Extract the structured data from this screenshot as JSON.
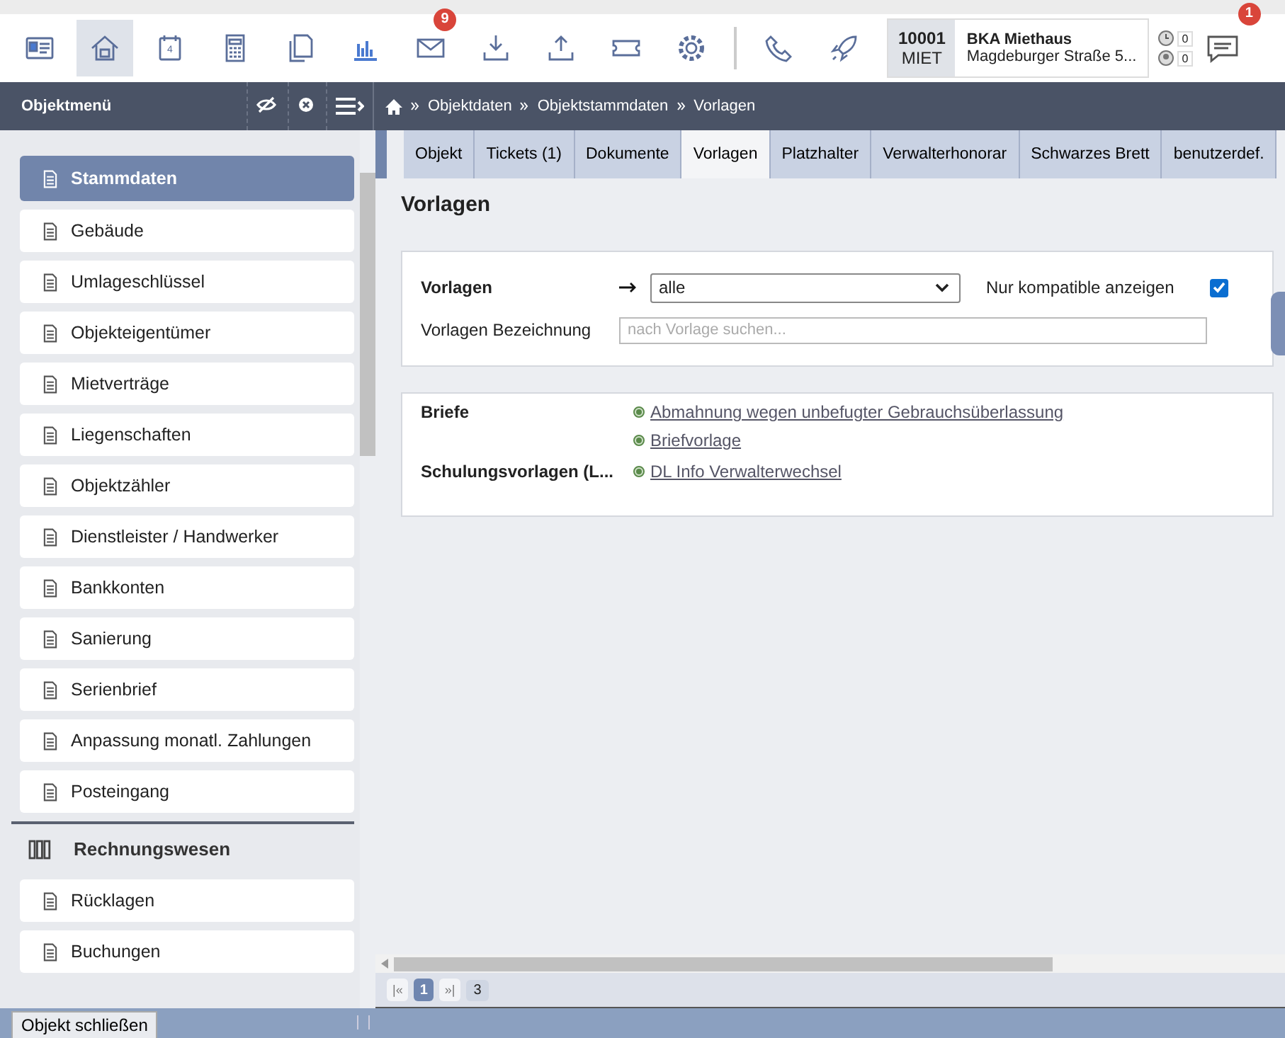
{
  "toolbar": {
    "icons": [
      {
        "kind": "card",
        "selected": false
      },
      {
        "kind": "home",
        "selected": true
      },
      {
        "kind": "calendar",
        "selected": false,
        "label": "4"
      },
      {
        "kind": "calculator",
        "selected": false
      },
      {
        "kind": "copy",
        "selected": false
      },
      {
        "kind": "chart",
        "selected": false
      },
      {
        "kind": "mail",
        "selected": false,
        "badge": "9"
      },
      {
        "kind": "download",
        "selected": false
      },
      {
        "kind": "upload",
        "selected": false
      },
      {
        "kind": "ticket",
        "selected": false
      },
      {
        "kind": "gear",
        "selected": false
      },
      {
        "kind": "divider"
      },
      {
        "kind": "phone",
        "selected": false
      },
      {
        "kind": "rocket",
        "selected": false
      }
    ],
    "object": {
      "number": "10001",
      "type": "MIET",
      "name": "BKA Miethaus",
      "address": "Magdeburger Straße 5..."
    },
    "counters": [
      "0",
      "0"
    ],
    "messages_badge": "1"
  },
  "menu_bar": {
    "title": "Objektmenü",
    "breadcrumb": [
      "Objektdaten",
      "Objektstammdaten",
      "Vorlagen"
    ]
  },
  "sidebar": {
    "items": [
      {
        "label": "Stammdaten",
        "selected": true
      },
      {
        "label": "Gebäude",
        "selected": false
      },
      {
        "label": "Umlageschlüssel",
        "selected": false
      },
      {
        "label": "Objekteigentümer",
        "selected": false
      },
      {
        "label": "Mietverträge",
        "selected": false
      },
      {
        "label": "Liegenschaften",
        "selected": false
      },
      {
        "label": "Objektzähler",
        "selected": false
      },
      {
        "label": "Dienstleister / Handwerker",
        "selected": false
      },
      {
        "label": "Bankkonten",
        "selected": false
      },
      {
        "label": "Sanierung",
        "selected": false
      },
      {
        "label": "Serienbrief",
        "selected": false
      },
      {
        "label": "Anpassung monatl. Zahlungen",
        "selected": false
      },
      {
        "label": "Posteingang",
        "selected": false
      }
    ],
    "group": {
      "title": "Rechnungswesen",
      "items": [
        {
          "label": "Rücklagen",
          "selected": false
        },
        {
          "label": "Buchungen",
          "selected": false
        }
      ]
    }
  },
  "tabs": [
    {
      "label": "Objekt",
      "selected": false
    },
    {
      "label": "Tickets (1)",
      "selected": false
    },
    {
      "label": "Dokumente",
      "selected": false
    },
    {
      "label": "Vorlagen",
      "selected": true
    },
    {
      "label": "Platzhalter",
      "selected": false
    },
    {
      "label": "Verwalterhonorar",
      "selected": false
    },
    {
      "label": "Schwarzes Brett",
      "selected": false
    },
    {
      "label": "benutzerdef.",
      "selected": false
    }
  ],
  "page_title": "Vorlagen",
  "filter": {
    "select_label": "Vorlagen",
    "select_value": "alle",
    "checkbox_label": "Nur kompatible anzeigen",
    "checked": true,
    "search_label": "Vorlagen Bezeichnung",
    "placeholder": "nach Vorlage suchen..."
  },
  "results": [
    {
      "label": "Briefe",
      "links": [
        "Abmahnung wegen unbefugter Gebrauchsüberlassung",
        "Briefvorlage"
      ]
    },
    {
      "label": "Schulungsvorlagen (L...",
      "links": [
        "DL Info Verwalterwechsel"
      ]
    }
  ],
  "pagination": {
    "first": "|«",
    "pages": [
      {
        "label": "1",
        "selected": true
      }
    ],
    "last": "»|",
    "total": "3"
  },
  "footer": {
    "button": "Objekt schließen"
  }
}
